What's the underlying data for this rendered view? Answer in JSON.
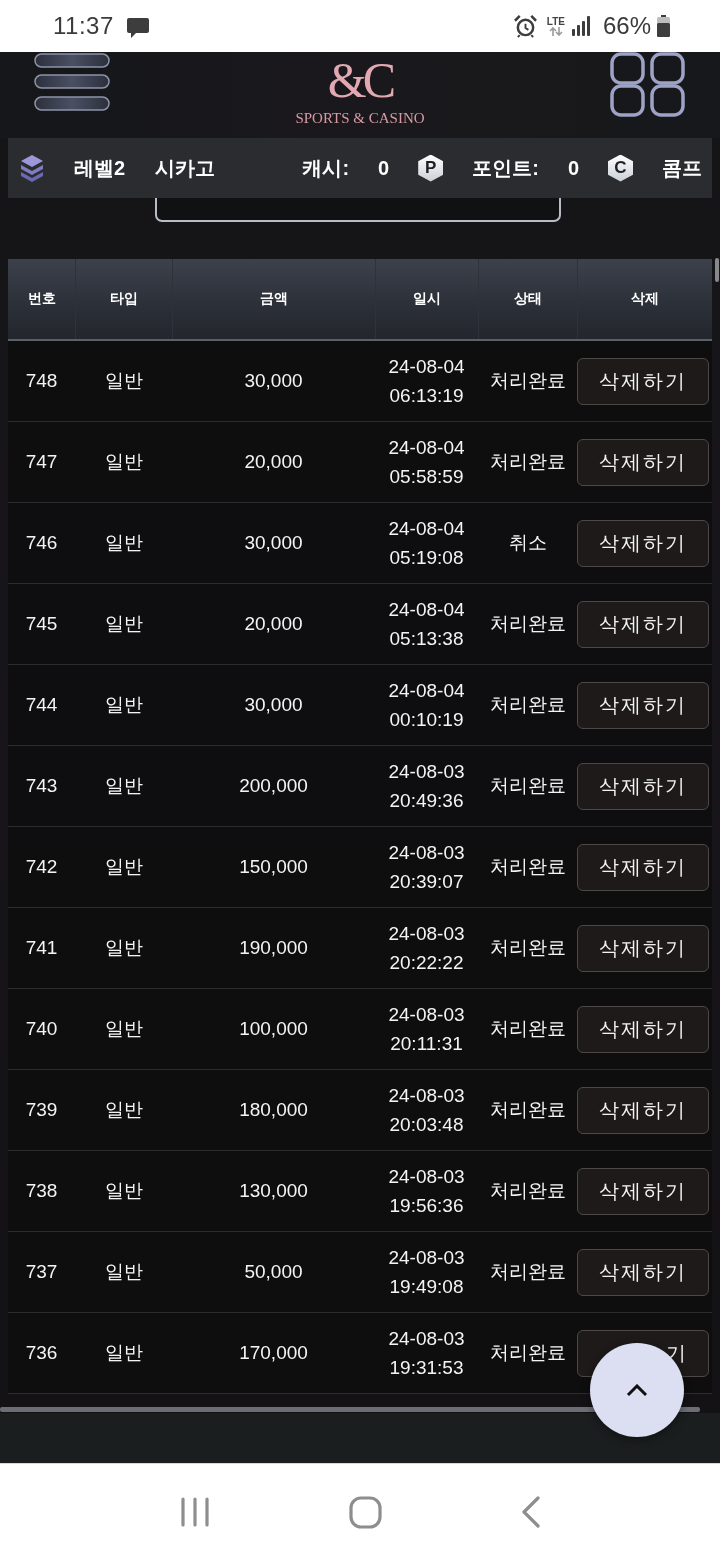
{
  "status_bar": {
    "time": "11:37",
    "network": "LTE",
    "battery": "66%"
  },
  "header": {
    "logo_mark": "&C",
    "logo_text": "SPORTS & CASINO"
  },
  "user_bar": {
    "level": "레벨2",
    "username": "시카고",
    "cash_label": "캐시:",
    "cash": "0",
    "cash_icon": "P",
    "points_label": "포인트:",
    "points": "0",
    "points_icon": "C",
    "comp_label": "콤프"
  },
  "table": {
    "columns": [
      "번호",
      "타입",
      "금액",
      "일시",
      "상태",
      "삭제"
    ],
    "rows": [
      {
        "no": "748",
        "type": "일반",
        "amount": "30,000",
        "date": "24-08-04",
        "time": "06:13:19",
        "status": "처리완료",
        "action": "삭제하기",
        "label_covered": false
      },
      {
        "no": "747",
        "type": "일반",
        "amount": "20,000",
        "date": "24-08-04",
        "time": "05:58:59",
        "status": "처리완료",
        "action": "삭제하기",
        "label_covered": false
      },
      {
        "no": "746",
        "type": "일반",
        "amount": "30,000",
        "date": "24-08-04",
        "time": "05:19:08",
        "status": "취소",
        "action": "삭제하기",
        "label_covered": false
      },
      {
        "no": "745",
        "type": "일반",
        "amount": "20,000",
        "date": "24-08-04",
        "time": "05:13:38",
        "status": "처리완료",
        "action": "삭제하기",
        "label_covered": false
      },
      {
        "no": "744",
        "type": "일반",
        "amount": "30,000",
        "date": "24-08-04",
        "time": "00:10:19",
        "status": "처리완료",
        "action": "삭제하기",
        "label_covered": false
      },
      {
        "no": "743",
        "type": "일반",
        "amount": "200,000",
        "date": "24-08-03",
        "time": "20:49:36",
        "status": "처리완료",
        "action": "삭제하기",
        "label_covered": false
      },
      {
        "no": "742",
        "type": "일반",
        "amount": "150,000",
        "date": "24-08-03",
        "time": "20:39:07",
        "status": "처리완료",
        "action": "삭제하기",
        "label_covered": false
      },
      {
        "no": "741",
        "type": "일반",
        "amount": "190,000",
        "date": "24-08-03",
        "time": "20:22:22",
        "status": "처리완료",
        "action": "삭제하기",
        "label_covered": false
      },
      {
        "no": "740",
        "type": "일반",
        "amount": "100,000",
        "date": "24-08-03",
        "time": "20:11:31",
        "status": "처리완료",
        "action": "삭제하기",
        "label_covered": false
      },
      {
        "no": "739",
        "type": "일반",
        "amount": "180,000",
        "date": "24-08-03",
        "time": "20:03:48",
        "status": "처리완료",
        "action": "삭제하기",
        "label_covered": false
      },
      {
        "no": "738",
        "type": "일반",
        "amount": "130,000",
        "date": "24-08-03",
        "time": "19:56:36",
        "status": "처리완료",
        "action": "삭제하기",
        "label_covered": false
      },
      {
        "no": "737",
        "type": "일반",
        "amount": "50,000",
        "date": "24-08-03",
        "time": "19:49:08",
        "status": "처리완료",
        "action": "삭제하기",
        "label_covered": false
      },
      {
        "no": "736",
        "type": "일반",
        "amount": "170,000",
        "date": "24-08-03",
        "time": "19:31:53",
        "status": "처리완료",
        "action": "기",
        "label_covered": true
      }
    ]
  }
}
